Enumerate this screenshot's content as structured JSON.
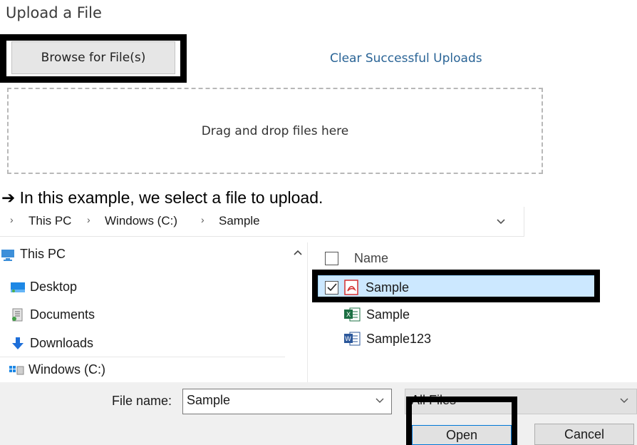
{
  "upload": {
    "title": "Upload a File",
    "browse_label": "Browse for File(s)",
    "clear_label": "Clear Successful Uploads",
    "dropzone_text": "Drag and drop files here"
  },
  "caption": {
    "arrow": "➔",
    "text": "In this example, we select a file to upload."
  },
  "dialog": {
    "breadcrumb": [
      "This PC",
      "Windows (C:)",
      "Sample"
    ],
    "breadcrumb_separator": "›",
    "nav_items": [
      {
        "label": "This PC",
        "icon": "pc-icon"
      },
      {
        "label": "Desktop",
        "icon": "desktop-icon"
      },
      {
        "label": "Documents",
        "icon": "documents-icon"
      },
      {
        "label": "Downloads",
        "icon": "downloads-icon"
      },
      {
        "label": "Windows (C:)",
        "icon": "drive-icon"
      }
    ],
    "column_header": "Name",
    "files": [
      {
        "name": "Sample",
        "icon": "pdf-icon",
        "selected": true
      },
      {
        "name": "Sample",
        "icon": "excel-icon",
        "selected": false
      },
      {
        "name": "Sample123",
        "icon": "word-icon",
        "selected": false
      }
    ],
    "file_name_label": "File name:",
    "file_name_value": "Sample",
    "file_type_value": "All Files",
    "open_label": "Open",
    "cancel_label": "Cancel"
  },
  "colors": {
    "link": "#2a6496",
    "selection": "#cce8ff",
    "pdf": "#d32f2f",
    "excel": "#1d7044",
    "word": "#2b579a",
    "highlight": "#000000"
  }
}
